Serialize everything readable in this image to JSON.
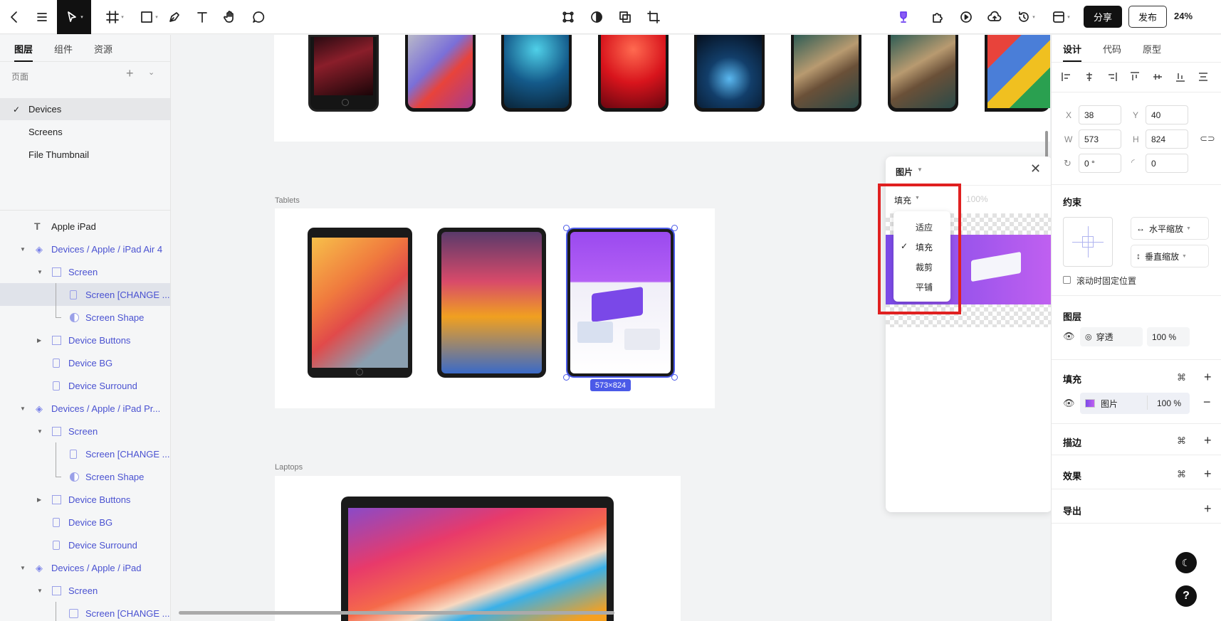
{
  "toolbar": {
    "share_label": "分享",
    "publish_label": "发布",
    "zoom": "24%"
  },
  "left_panel": {
    "tabs": [
      "图层",
      "组件",
      "资源"
    ],
    "pages_header": "页面",
    "pages": [
      "Devices",
      "Screens",
      "File Thumbnail"
    ],
    "layers": [
      {
        "label": "Apple iPad",
        "type": "text"
      },
      {
        "label": "Devices / Apple / iPad Air 4",
        "type": "component"
      },
      {
        "label": "Screen",
        "type": "frame"
      },
      {
        "label": "Screen [CHANGE ...",
        "type": "rect"
      },
      {
        "label": "Screen Shape",
        "type": "shape"
      },
      {
        "label": "Device Buttons",
        "type": "frame"
      },
      {
        "label": "Device BG",
        "type": "rect"
      },
      {
        "label": "Device Surround",
        "type": "rect"
      },
      {
        "label": "Devices / Apple / iPad Pr...",
        "type": "component"
      },
      {
        "label": "Screen",
        "type": "frame"
      },
      {
        "label": "Screen [CHANGE ...",
        "type": "rect"
      },
      {
        "label": "Screen Shape",
        "type": "shape"
      },
      {
        "label": "Device Buttons",
        "type": "frame"
      },
      {
        "label": "Device BG",
        "type": "rect"
      },
      {
        "label": "Device Surround",
        "type": "rect"
      },
      {
        "label": "Devices / Apple / iPad",
        "type": "component"
      },
      {
        "label": "Screen",
        "type": "frame"
      },
      {
        "label": "Screen [CHANGE ...",
        "type": "image"
      }
    ]
  },
  "canvas": {
    "section_tablets": "Tablets",
    "section_laptops": "Laptops",
    "size_badge": "573×824"
  },
  "image_popup": {
    "title": "图片",
    "mode": "填充",
    "opacity": "100%",
    "options": [
      "适应",
      "填充",
      "裁剪",
      "平铺"
    ],
    "selected": "填充"
  },
  "right_panel": {
    "tabs": [
      "设计",
      "代码",
      "原型"
    ],
    "x_label": "X",
    "x": "38",
    "y_label": "Y",
    "y": "40",
    "w_label": "W",
    "w": "573",
    "h_label": "H",
    "h": "824",
    "rotation": "0 °",
    "radius": "0",
    "constraints_title": "约束",
    "h_constraint": "水平缩放",
    "v_constraint": "垂直缩放",
    "fix_on_scroll": "滚动时固定位置",
    "layer_title": "图层",
    "blend": "穿透",
    "layer_opacity": "100 %",
    "fill_title": "填充",
    "fill_type": "图片",
    "fill_opacity": "100 %",
    "stroke_title": "描边",
    "effect_title": "效果",
    "export_title": "导出"
  },
  "colors": {
    "accent": "#4a52d1",
    "highlight": "#e02020",
    "badge": "#4b5ae8"
  }
}
